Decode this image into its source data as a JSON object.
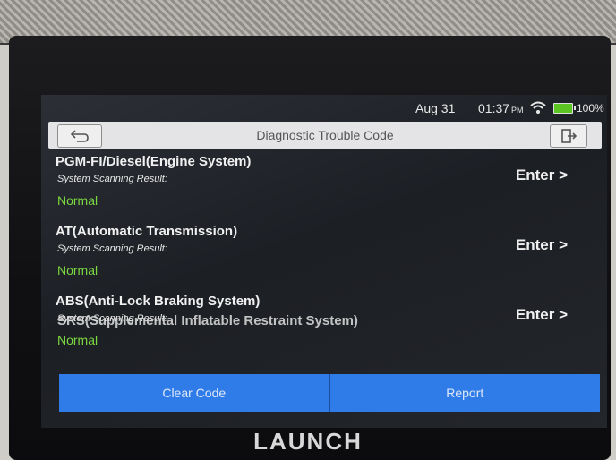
{
  "status": {
    "date": "Aug 31",
    "time": "01:37",
    "ampm": "PM",
    "battery": "100%"
  },
  "header": {
    "title": "Diagnostic Trouble Code"
  },
  "systems": [
    {
      "name": "PGM-FI/Diesel(Engine System)",
      "label": "System Scanning Result:",
      "result": "Normal",
      "enter": "Enter >"
    },
    {
      "name": "AT(Automatic Transmission)",
      "label": "System Scanning Result:",
      "result": "Normal",
      "enter": "Enter >"
    },
    {
      "name": "ABS(Anti-Lock Braking System)",
      "label": "System Scanning Result:",
      "result": "Normal",
      "enter": "Enter >"
    },
    {
      "name": "SRS(Supplemental Inflatable Restraint System)"
    }
  ],
  "actions": {
    "clear": "Clear Code",
    "report": "Report"
  },
  "device": {
    "brand": "LAUNCH"
  },
  "colors": {
    "normal": "#7cd840",
    "action_bar": "#2f7ce8",
    "battery": "#5cc524"
  }
}
